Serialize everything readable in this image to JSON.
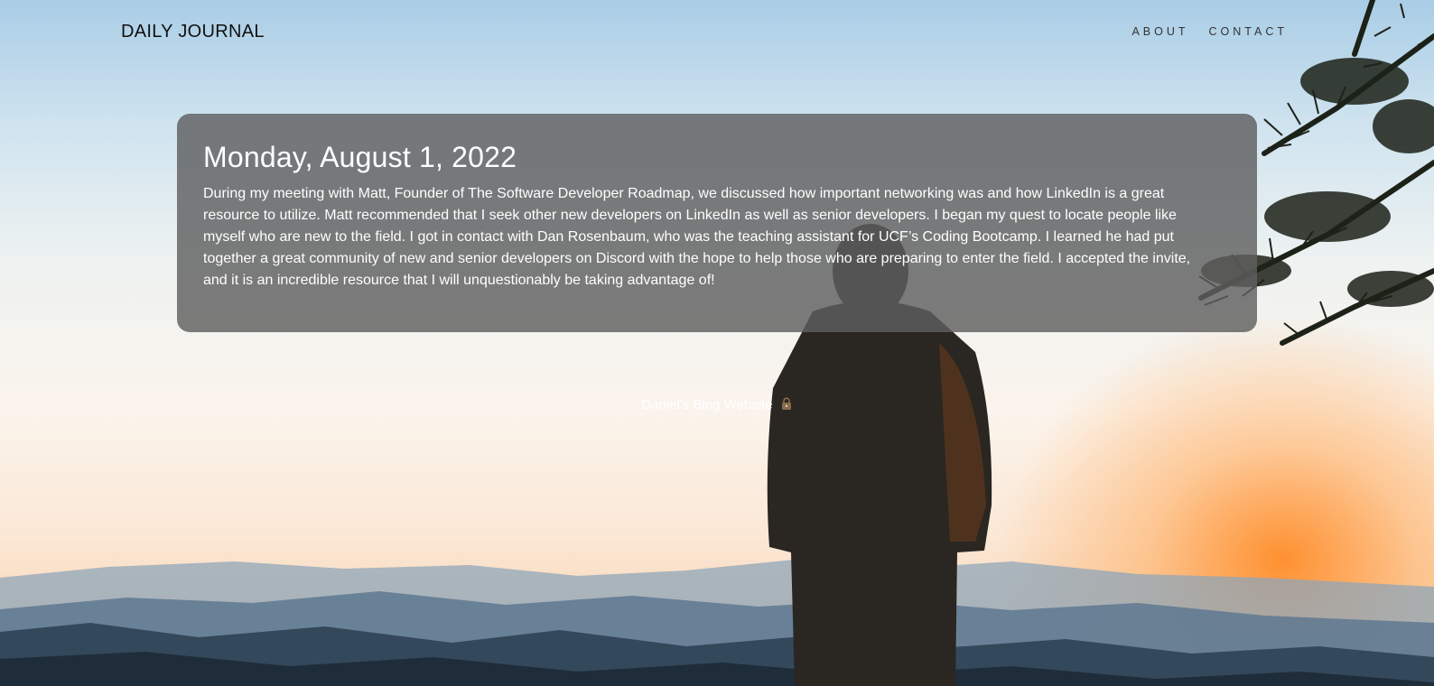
{
  "header": {
    "brand": "DAILY JOURNAL",
    "nav": [
      {
        "label": "ABOUT"
      },
      {
        "label": "CONTACT"
      }
    ]
  },
  "post": {
    "date": "Monday, August 1, 2022",
    "body": "During my meeting with Matt, Founder of The Software Developer Roadmap, we discussed how important networking was and how LinkedIn is a great resource to utilize. Matt recommended that I seek other new developers on LinkedIn as well as senior developers. I began my quest to locate people like myself who are new to the field. I got in contact with Dan Rosenbaum, who was the teaching assistant for UCF’s Coding Bootcamp. I learned he had put together a great community of new and senior developers on Discord with the hope to help those who are preparing to enter the field. I accepted the invite, and it is an incredible resource that I will unquestionably be taking advantage of!"
  },
  "footer": {
    "text": "Daniel's Blog Website",
    "icon": "lock-icon"
  },
  "colors": {
    "card_bg": "#5f5f5f",
    "text_light": "#ffffff",
    "brand_text": "#111111"
  }
}
